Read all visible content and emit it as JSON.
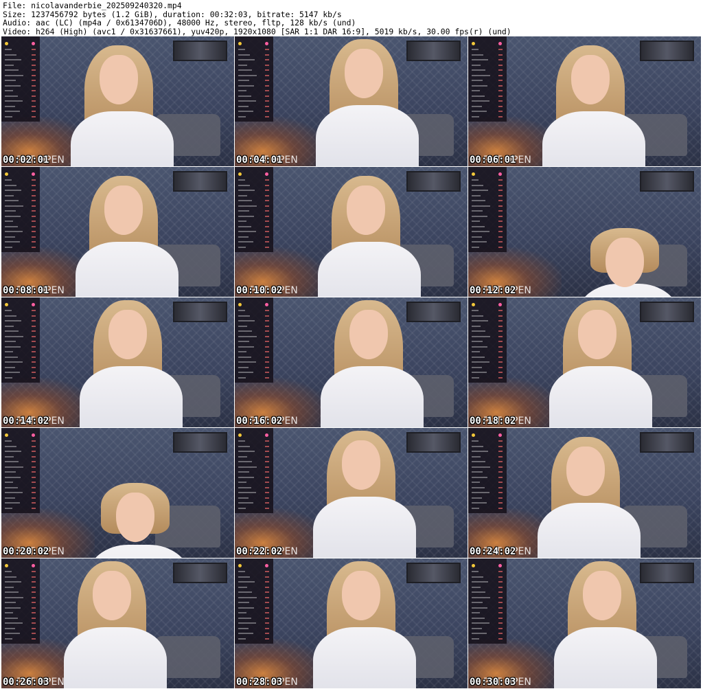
{
  "header": {
    "line1": "File: nicolavanderbie_202509240320.mp4",
    "line2": "Size: 1237456792 bytes (1.2 GiB), duration: 00:32:03, bitrate: 5147 kb/s",
    "line3": "Audio: aac (LC) (mp4a / 0x6134706D), 48000 Hz, stereo, fltp, 128 kb/s (und)",
    "line4": "Video: h264 (High) (avc1 / 0x31637661), yuv420p, 1920x1080 [SAR 1:1 DAR 16:9], 5019 kb/s, 30.00 fps(r) (und)"
  },
  "watermark": "PVT OPEN",
  "frames": [
    {
      "timestamp": "00:02:01"
    },
    {
      "timestamp": "00:04:01"
    },
    {
      "timestamp": "00:06:01"
    },
    {
      "timestamp": "00:08:01"
    },
    {
      "timestamp": "00:10:02"
    },
    {
      "timestamp": "00:12:02"
    },
    {
      "timestamp": "00:14:02"
    },
    {
      "timestamp": "00:16:02"
    },
    {
      "timestamp": "00:18:02"
    },
    {
      "timestamp": "00:20:02"
    },
    {
      "timestamp": "00:22:02"
    },
    {
      "timestamp": "00:24:02"
    },
    {
      "timestamp": "00:26:03"
    },
    {
      "timestamp": "00:28:03"
    },
    {
      "timestamp": "00:30:03"
    }
  ],
  "colors": {
    "wall": "#4a556f",
    "lamp": "#e68c3c",
    "shirt": "#f4f3f6",
    "hair": "#c9a676",
    "overlay_accent": "#ff5fa2"
  }
}
